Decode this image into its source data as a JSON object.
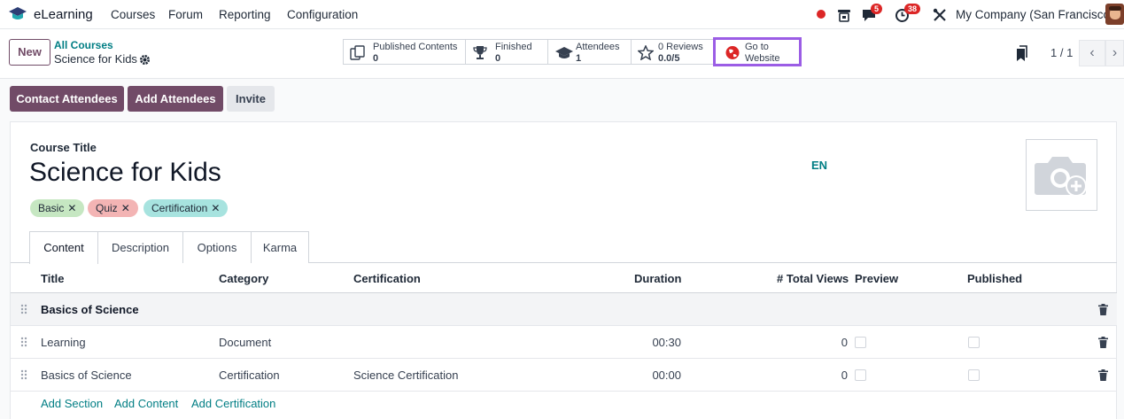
{
  "app": {
    "brand": "eLearning",
    "menu": [
      "Courses",
      "Forum",
      "Reporting",
      "Configuration"
    ],
    "messages_count": "5",
    "activities_count": "38",
    "company": "My Company (San Francisco)"
  },
  "control_panel": {
    "new_label": "New",
    "breadcrumb_parent": "All Courses",
    "breadcrumb_current": "Science for Kids",
    "stats": [
      {
        "title": "Published Contents",
        "value": "0",
        "icon": "copy-icon"
      },
      {
        "title": "Finished",
        "value": "0",
        "icon": "trophy-icon"
      },
      {
        "title": "Attendees",
        "value": "1",
        "icon": "graduation-cap-icon"
      },
      {
        "title": "0 Reviews",
        "value": "0.0/5",
        "icon": "star-icon"
      },
      {
        "title": "Go to",
        "value": "Website",
        "icon": "globe-icon"
      }
    ],
    "pager": "1 / 1"
  },
  "actions": {
    "contact_attendees": "Contact Attendees",
    "add_attendees": "Add Attendees",
    "invite": "Invite"
  },
  "form": {
    "title_label": "Course Title",
    "title": "Science for Kids",
    "lang": "EN",
    "tags": [
      {
        "label": "Basic",
        "color": "#c6e7c2"
      },
      {
        "label": "Quiz",
        "color": "#f3b4b4"
      },
      {
        "label": "Certification",
        "color": "#a7e3df"
      }
    ],
    "tabs": [
      "Content",
      "Description",
      "Options",
      "Karma"
    ],
    "active_tab": "Content"
  },
  "table": {
    "columns": [
      "Title",
      "Category",
      "Certification",
      "Duration",
      "# Total Views",
      "Preview",
      "Published"
    ],
    "rows": [
      {
        "type": "section",
        "title": "Basics of Science"
      },
      {
        "type": "line",
        "title": "Learning",
        "category": "Document",
        "certification": "",
        "duration": "00:30",
        "views": "0"
      },
      {
        "type": "line",
        "title": "Basics of Science",
        "category": "Certification",
        "certification": "Science Certification",
        "duration": "00:00",
        "views": "0"
      }
    ],
    "add_links": [
      "Add Section",
      "Add Content",
      "Add Certification"
    ]
  },
  "colors": {
    "primary": "#714b67",
    "link": "#017e84",
    "highlight": "#9b5de5"
  }
}
